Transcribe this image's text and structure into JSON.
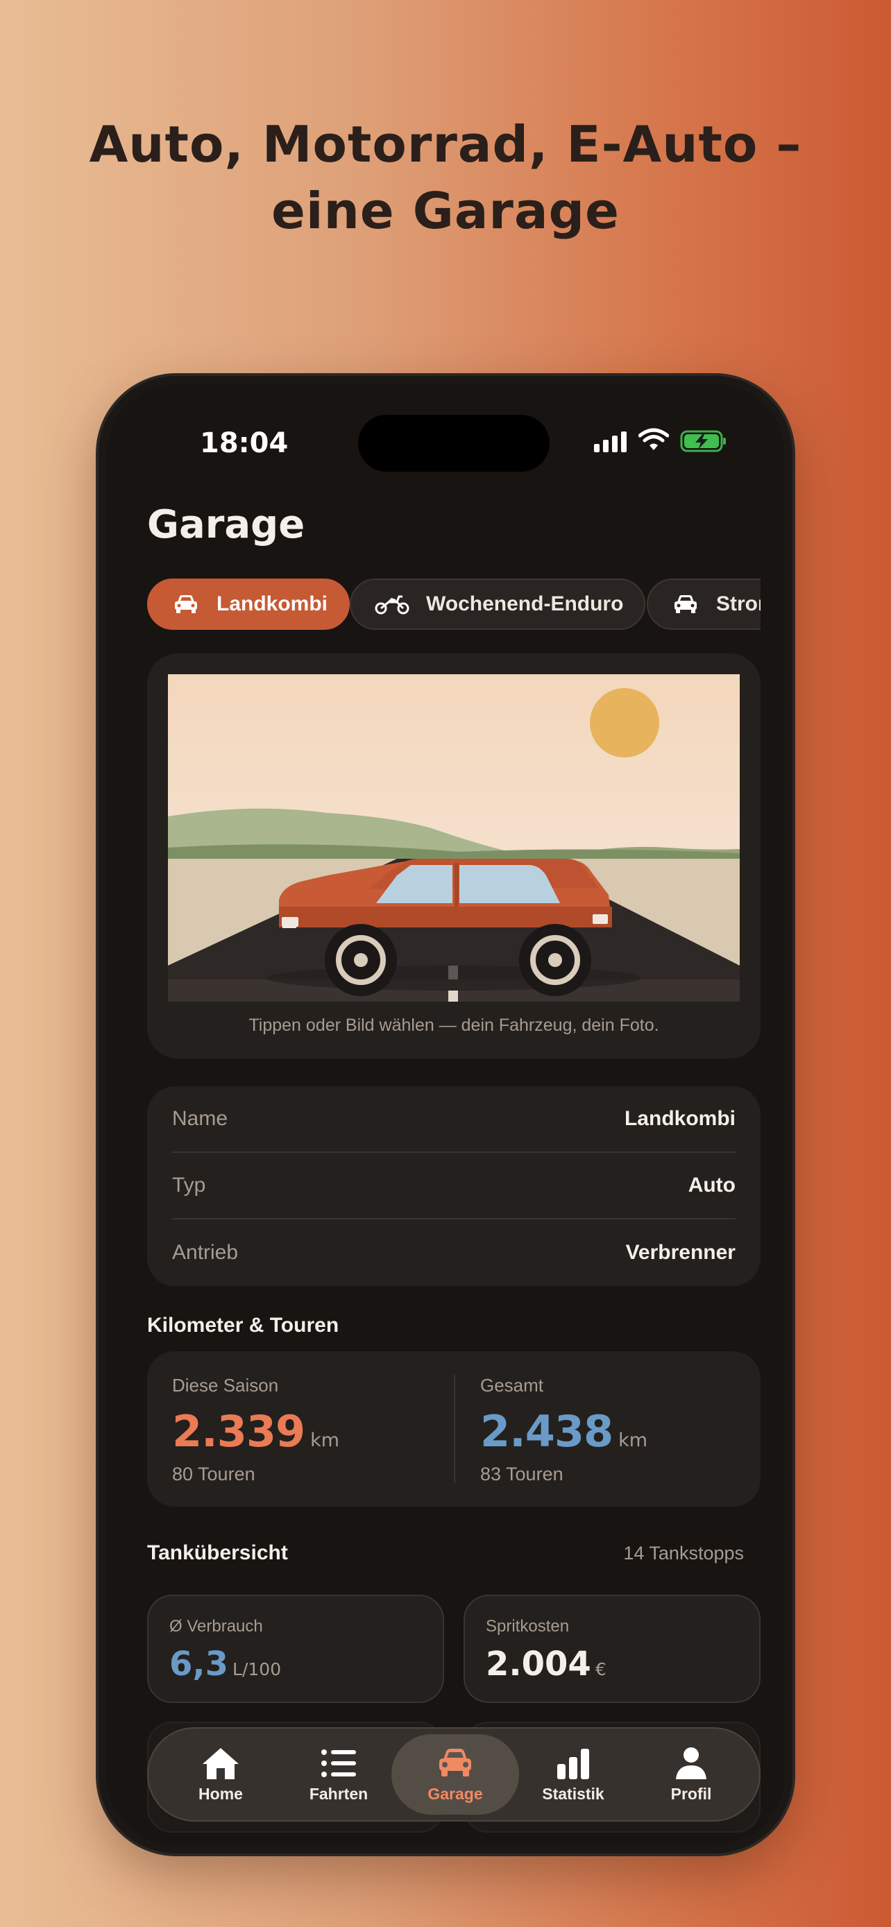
{
  "headline": {
    "line1": "Auto, Motorrad, E-Auto –",
    "line2": "eine Garage"
  },
  "status_bar": {
    "time": "18:04"
  },
  "page_title": "Garage",
  "vehicles": [
    {
      "label": "Landkombi",
      "icon": "car-icon",
      "active": true
    },
    {
      "label": "Wochenend-Enduro",
      "icon": "motorcycle-icon",
      "active": false
    },
    {
      "label": "Strom",
      "icon": "car-icon",
      "active": false
    }
  ],
  "photo": {
    "caption": "Tippen oder Bild wählen — dein Fahrzeug, dein Foto."
  },
  "details": [
    {
      "label": "Name",
      "value": "Landkombi"
    },
    {
      "label": "Typ",
      "value": "Auto"
    },
    {
      "label": "Antrieb",
      "value": "Verbrenner"
    }
  ],
  "km_section": {
    "title": "Kilometer & Touren",
    "season": {
      "label": "Diese Saison",
      "value": "2.339",
      "unit": "km",
      "tours": "80 Touren"
    },
    "total": {
      "label": "Gesamt",
      "value": "2.438",
      "unit": "km",
      "tours": "83 Touren"
    }
  },
  "tank_section": {
    "title": "Tankübersicht",
    "stops": "14 Tankstopps",
    "consumption": {
      "label": "Ø Verbrauch",
      "value": "6,3",
      "unit": "L/100"
    },
    "fuel_cost": {
      "label": "Spritkosten",
      "value": "2.004",
      "unit": "€"
    }
  },
  "tabs": [
    {
      "label": "Home",
      "icon": "home-icon"
    },
    {
      "label": "Fahrten",
      "icon": "list-icon"
    },
    {
      "label": "Garage",
      "icon": "car-icon",
      "active": true
    },
    {
      "label": "Statistik",
      "icon": "bar-chart-icon"
    },
    {
      "label": "Profil",
      "icon": "person-icon"
    }
  ],
  "colors": {
    "accent": "#c65a35",
    "season_value": "#ea7b55",
    "total_value": "#6a9ac8",
    "card": "#24201d",
    "screen": "#171412"
  }
}
